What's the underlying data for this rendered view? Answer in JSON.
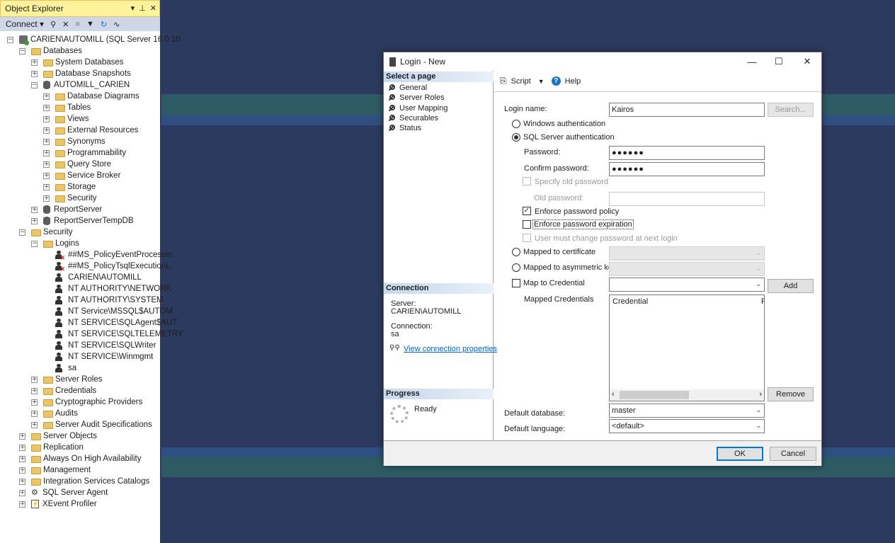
{
  "object_explorer": {
    "title": "Object Explorer",
    "connect_label": "Connect",
    "tree": [
      {
        "label": "CARIEN\\AUTOMILL (SQL Server 16.0.10",
        "level": 0,
        "exp": "−",
        "icon": "server"
      },
      {
        "label": "Databases",
        "level": 1,
        "exp": "−",
        "icon": "folder"
      },
      {
        "label": "System Databases",
        "level": 2,
        "exp": "+",
        "icon": "folder"
      },
      {
        "label": "Database Snapshots",
        "level": 2,
        "exp": "+",
        "icon": "folder"
      },
      {
        "label": "AUTOMILL_CARIEN",
        "level": 2,
        "exp": "−",
        "icon": "db"
      },
      {
        "label": "Database Diagrams",
        "level": 3,
        "exp": "+",
        "icon": "folder"
      },
      {
        "label": "Tables",
        "level": 3,
        "exp": "+",
        "icon": "folder"
      },
      {
        "label": "Views",
        "level": 3,
        "exp": "+",
        "icon": "folder"
      },
      {
        "label": "External Resources",
        "level": 3,
        "exp": "+",
        "icon": "folder"
      },
      {
        "label": "Synonyms",
        "level": 3,
        "exp": "+",
        "icon": "folder"
      },
      {
        "label": "Programmability",
        "level": 3,
        "exp": "+",
        "icon": "folder"
      },
      {
        "label": "Query Store",
        "level": 3,
        "exp": "+",
        "icon": "folder"
      },
      {
        "label": "Service Broker",
        "level": 3,
        "exp": "+",
        "icon": "folder"
      },
      {
        "label": "Storage",
        "level": 3,
        "exp": "+",
        "icon": "folder"
      },
      {
        "label": "Security",
        "level": 3,
        "exp": "+",
        "icon": "folder"
      },
      {
        "label": "ReportServer",
        "level": 2,
        "exp": "+",
        "icon": "db"
      },
      {
        "label": "ReportServerTempDB",
        "level": 2,
        "exp": "+",
        "icon": "db"
      },
      {
        "label": "Security",
        "level": 1,
        "exp": "−",
        "icon": "folder"
      },
      {
        "label": "Logins",
        "level": 2,
        "exp": "−",
        "icon": "folder"
      },
      {
        "label": "##MS_PolicyEventProcessin",
        "level": 3,
        "exp": "",
        "icon": "user-x"
      },
      {
        "label": "##MS_PolicyTsqlExecutionL",
        "level": 3,
        "exp": "",
        "icon": "user-x"
      },
      {
        "label": "CARIEN\\AUTOMILL",
        "level": 3,
        "exp": "",
        "icon": "user"
      },
      {
        "label": "NT AUTHORITY\\NETWORK",
        "level": 3,
        "exp": "",
        "icon": "user"
      },
      {
        "label": "NT AUTHORITY\\SYSTEM",
        "level": 3,
        "exp": "",
        "icon": "user"
      },
      {
        "label": "NT Service\\MSSQL$AUTOM",
        "level": 3,
        "exp": "",
        "icon": "user"
      },
      {
        "label": "NT SERVICE\\SQLAgent$AUT",
        "level": 3,
        "exp": "",
        "icon": "user"
      },
      {
        "label": "NT SERVICE\\SQLTELEMETRY",
        "level": 3,
        "exp": "",
        "icon": "user"
      },
      {
        "label": "NT SERVICE\\SQLWriter",
        "level": 3,
        "exp": "",
        "icon": "user"
      },
      {
        "label": "NT SERVICE\\Winmgmt",
        "level": 3,
        "exp": "",
        "icon": "user"
      },
      {
        "label": "sa",
        "level": 3,
        "exp": "",
        "icon": "user"
      },
      {
        "label": "Server Roles",
        "level": 2,
        "exp": "+",
        "icon": "folder"
      },
      {
        "label": "Credentials",
        "level": 2,
        "exp": "+",
        "icon": "folder"
      },
      {
        "label": "Cryptographic Providers",
        "level": 2,
        "exp": "+",
        "icon": "folder"
      },
      {
        "label": "Audits",
        "level": 2,
        "exp": "+",
        "icon": "folder"
      },
      {
        "label": "Server Audit Specifications",
        "level": 2,
        "exp": "+",
        "icon": "folder"
      },
      {
        "label": "Server Objects",
        "level": 1,
        "exp": "+",
        "icon": "folder"
      },
      {
        "label": "Replication",
        "level": 1,
        "exp": "+",
        "icon": "folder"
      },
      {
        "label": "Always On High Availability",
        "level": 1,
        "exp": "+",
        "icon": "folder"
      },
      {
        "label": "Management",
        "level": 1,
        "exp": "+",
        "icon": "folder"
      },
      {
        "label": "Integration Services Catalogs",
        "level": 1,
        "exp": "+",
        "icon": "folder"
      },
      {
        "label": "SQL Server Agent",
        "level": 1,
        "exp": "+",
        "icon": "agent"
      },
      {
        "label": "XEvent Profiler",
        "level": 1,
        "exp": "+",
        "icon": "xevent"
      }
    ]
  },
  "dialog": {
    "title": "Login - New",
    "select_page_header": "Select a page",
    "pages": [
      "General",
      "Server Roles",
      "User Mapping",
      "Securables",
      "Status"
    ],
    "connection_header": "Connection",
    "server_label": "Server:",
    "server_value": "CARIEN\\AUTOMILL",
    "connection_label": "Connection:",
    "connection_value": "sa",
    "view_connection_link": "View connection properties",
    "progress_header": "Progress",
    "progress_status": "Ready",
    "toolbar": {
      "script_label": "Script",
      "help_label": "Help"
    },
    "form": {
      "login_name_label": "Login name:",
      "login_name_value": "Kairos",
      "search_button": "Search...",
      "windows_auth": "Windows authentication",
      "sql_auth": "SQL Server authentication",
      "password_label": "Password:",
      "password_value": "●●●●●●",
      "confirm_password_label": "Confirm password:",
      "confirm_password_value": "●●●●●●",
      "specify_old_password": "Specify old password",
      "old_password_label": "Old password:",
      "enforce_policy": "Enforce password policy",
      "enforce_expiration": "Enforce password expiration",
      "must_change": "User must change password at next login",
      "mapped_certificate": "Mapped to certificate",
      "mapped_asymmetric": "Mapped to asymmetric key",
      "map_credential": "Map to Credential",
      "add_button": "Add",
      "mapped_credentials_label": "Mapped Credentials",
      "credential_col": "Credential",
      "provider_col_partial": "F",
      "remove_button": "Remove",
      "default_database_label": "Default database:",
      "default_database_value": "master",
      "default_language_label": "Default language:",
      "default_language_value": "<default>"
    },
    "ok_button": "OK",
    "cancel_button": "Cancel"
  }
}
